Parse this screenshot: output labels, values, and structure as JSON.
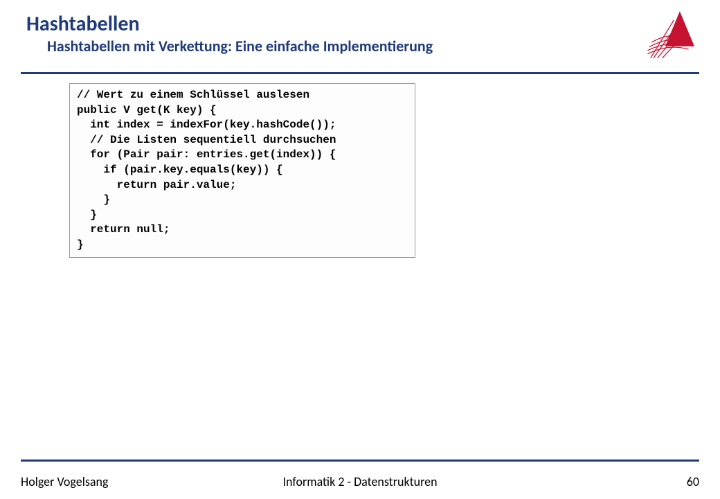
{
  "header": {
    "title": "Hashtabellen",
    "subtitle": "Hashtabellen mit Verkettung: Eine einfache Implementierung"
  },
  "code": "// Wert zu einem Schlüssel auslesen\npublic V get(K key) {\n  int index = indexFor(key.hashCode());\n  // Die Listen sequentiell durchsuchen\n  for (Pair pair: entries.get(index)) {\n    if (pair.key.equals(key)) {\n      return pair.value;\n    }\n  }\n  return null;\n}",
  "footer": {
    "author": "Holger Vogelsang",
    "center": "Informatik 2 - Datenstrukturen",
    "page": "60"
  }
}
